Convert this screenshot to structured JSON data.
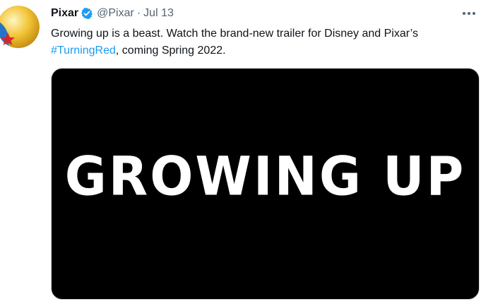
{
  "tweet": {
    "display_name": "Pixar",
    "handle": "@Pixar",
    "separator": "·",
    "date": "Jul 13",
    "text_before": "Growing up is a beast. Watch the brand-new trailer for Disney and Pixar’s ",
    "hashtag": "#TurningRed",
    "text_after": ", coming Spring 2022.",
    "media": {
      "overlay_text": "GROWING UP"
    }
  },
  "icons": {
    "avatar": "pixar-luxo-ball-icon",
    "verified": "verified-badge-icon",
    "more": "more-options-icon"
  },
  "colors": {
    "text": "#0f1419",
    "secondary": "#536471",
    "link": "#1d9bf0",
    "verified": "#1d9bf0",
    "media_background": "#000000",
    "media_text": "#ffffff"
  }
}
